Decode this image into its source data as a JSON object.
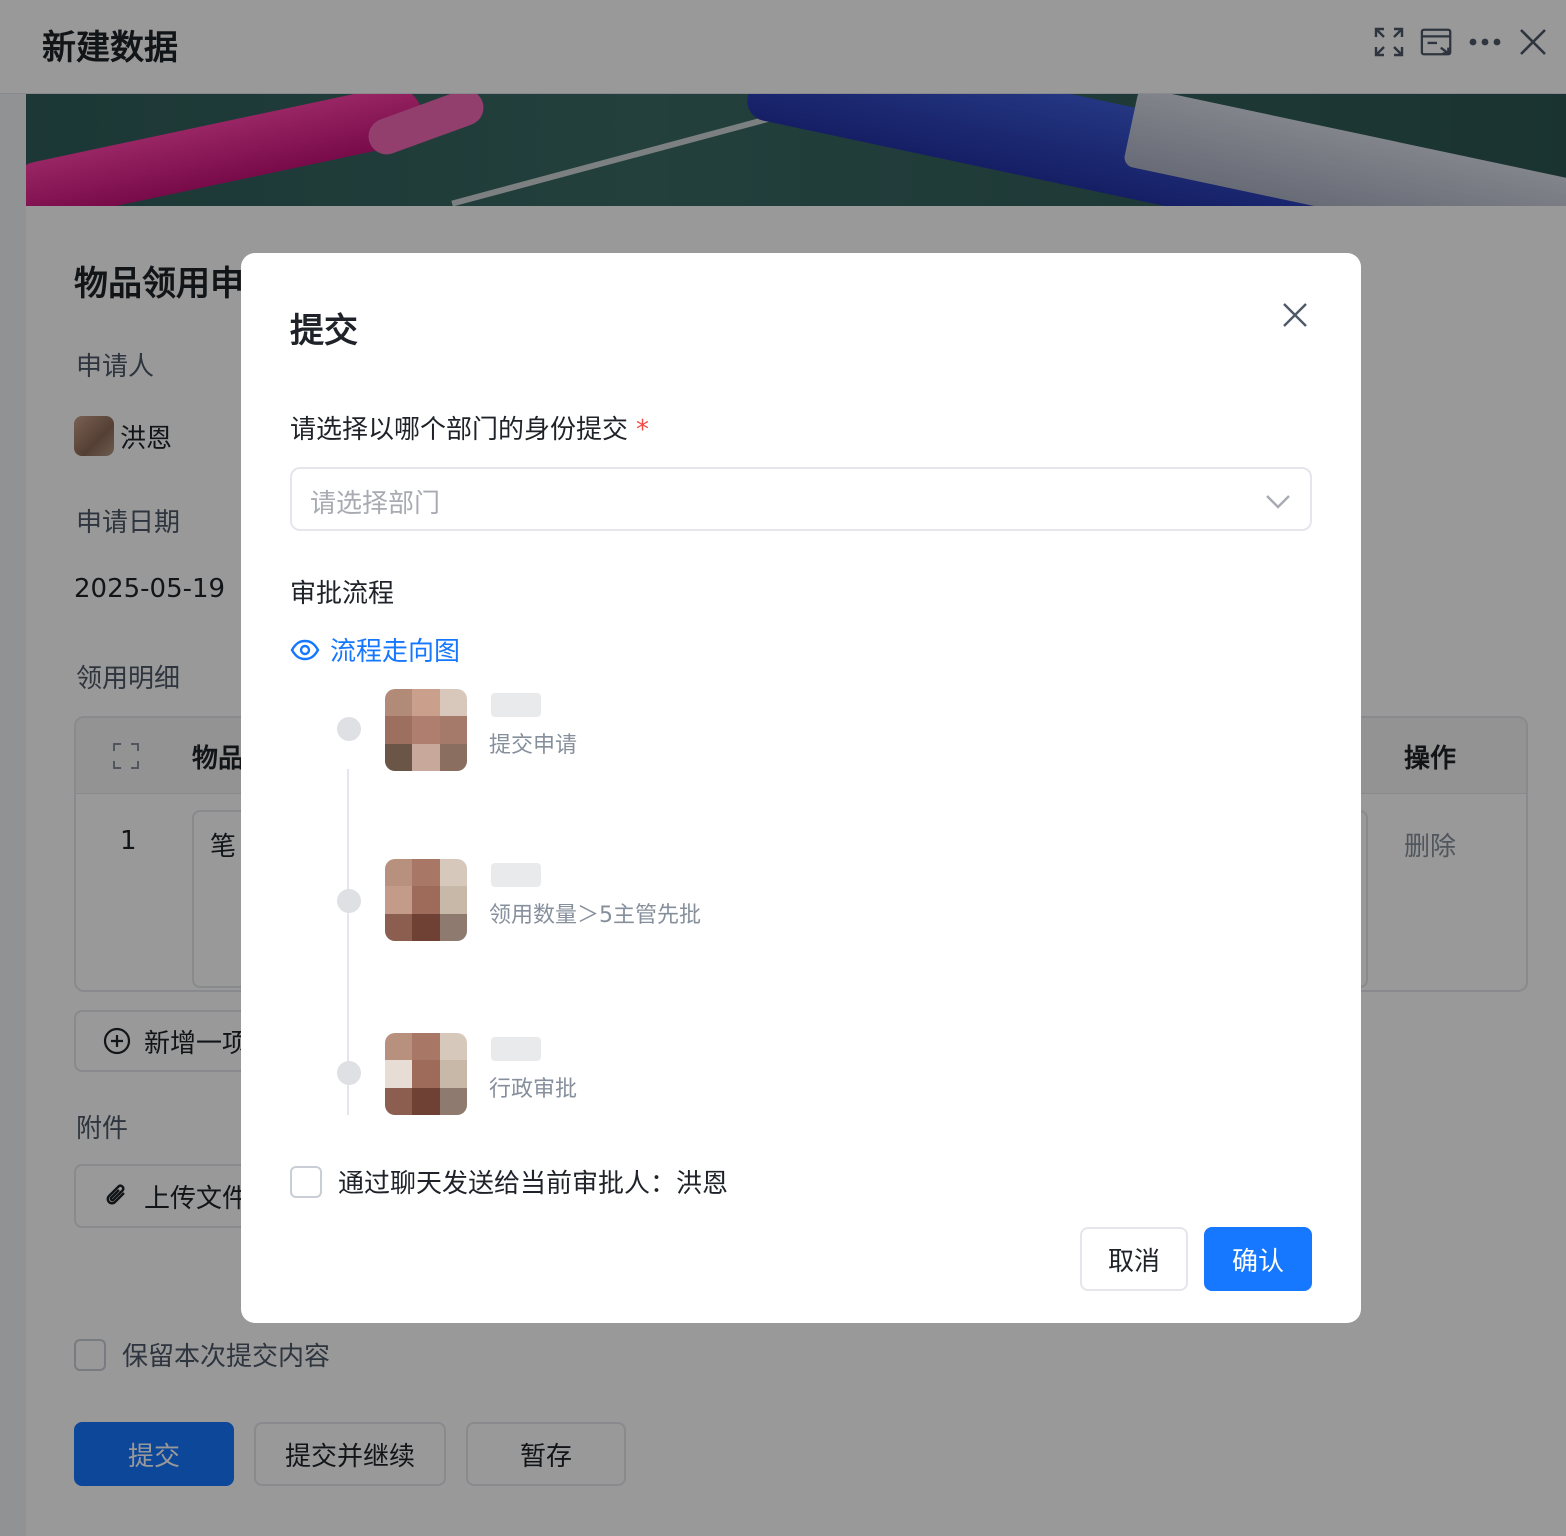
{
  "window": {
    "title": "新建数据"
  },
  "form": {
    "title": "物品领用申",
    "applicant_label": "申请人",
    "applicant_name": "洪恩",
    "date_label": "申请日期",
    "date_value": "2025-05-19",
    "detail_label": "领用明细",
    "table": {
      "col_item": "物品",
      "col_op": "操作",
      "row_index": "1",
      "row_item_value": "笔",
      "row_delete": "删除"
    },
    "add_row_label": "新增一项",
    "attachment_label": "附件",
    "upload_label": "上传文件",
    "keep_label": "保留本次提交内容",
    "buttons": {
      "submit": "提交",
      "submit_continue": "提交并继续",
      "save_draft": "暂存"
    }
  },
  "modal": {
    "title": "提交",
    "dept_label": "请选择以哪个部门的身份提交",
    "required_mark": "*",
    "dept_placeholder": "请选择部门",
    "flow_label": "审批流程",
    "flow_link": "流程走向图",
    "steps": [
      {
        "desc": "提交申请"
      },
      {
        "desc": "领用数量＞5主管先批"
      },
      {
        "desc": "行政审批"
      }
    ],
    "notify_label": "通过聊天发送给当前审批人：洪恩",
    "cancel": "取消",
    "confirm": "确认"
  },
  "colors": {
    "primary": "#1677ff",
    "required": "#f54a45",
    "mask": "rgba(0,0,0,0.4)"
  },
  "icons": [
    "fullscreen-icon",
    "browser-window-icon",
    "more-icon",
    "close-icon",
    "expand-icon",
    "chevron-down-icon",
    "eye-icon",
    "plus-circle-icon",
    "paperclip-icon"
  ]
}
